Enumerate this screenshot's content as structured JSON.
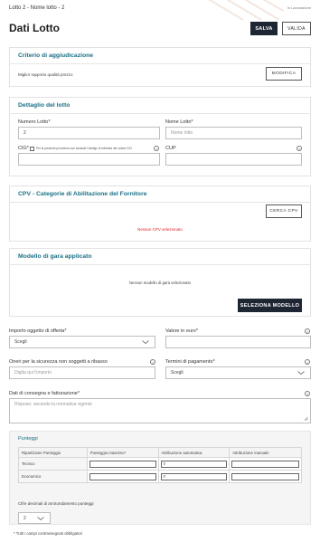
{
  "header": {
    "breadcrumb": "Lotto 2 - Nome lotto - 2",
    "status": "In Lavorazione",
    "title": "Dati Lotto",
    "save_label": "SALVA",
    "validate_label": "VALIDA"
  },
  "criterio": {
    "heading": "Criterio di aggiudicazione",
    "value": "Miglior rapporto qualità prezzo",
    "modify_label": "MODIFICA"
  },
  "dettaglio": {
    "heading": "Dettaglio del lotto",
    "numero_label": "Numero Lotto*",
    "numero_value": "2",
    "nome_label": "Nome Lotto*",
    "nome_placeholder": "Nome lotto",
    "cig_label": "CIG*",
    "cig_checkbox_label": "Per la presente procedura non sussiste l'obbligo di richiesta del codice CIG",
    "cup_label": "CUP"
  },
  "cpv": {
    "heading": "CPV - Categorie di Abilitazione del Fornitore",
    "search_label": "CERCA CPV",
    "empty_message": "Nessun CPV selezionato"
  },
  "modello": {
    "heading": "Modello di gara applicato",
    "empty_message": "Nessun modello di gara selezionato",
    "select_label": "SELEZIONA MODELLO"
  },
  "form": {
    "importo_label": "Importo oggetto di offerta*",
    "importo_value": "Scegli",
    "valore_label": "Valore in euro*",
    "oneri_label": "Oneri per la sicurezza non soggetti a ribasso",
    "oneri_placeholder": "Digita qui l'importo",
    "termini_label": "Termini di pagamento*",
    "termini_value": "Scegli",
    "consegna_label": "Dati di consegna e fatturazione*",
    "consegna_placeholder": "Rispose: secondo la normativa vigente"
  },
  "punteggi": {
    "heading": "Punteggi",
    "columns": [
      "Ripartizione Punteggio",
      "Punteggio massimo*",
      "Attribuzione automatica",
      "Attribuzione manuale"
    ],
    "rows": [
      {
        "name": "Tecnico",
        "auto": "0"
      },
      {
        "name": "Economico",
        "auto": "0"
      }
    ],
    "decimals_label": "Cifre decimali di arrotondamento punteggi",
    "decimals_value": "2"
  },
  "footnote": "* Tutti i campi contrassegnati obbligatori",
  "colors": {
    "accent": "#1a6f86",
    "dark_button": "#1f2633",
    "error": "#dd2222"
  }
}
